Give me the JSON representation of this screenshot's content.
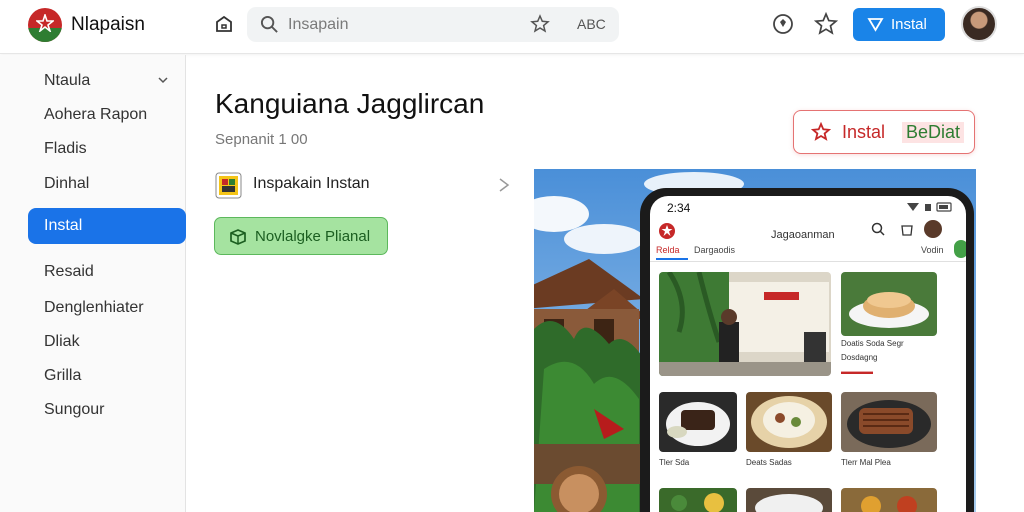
{
  "header": {
    "app_name": "Nlapaisn",
    "search_placeholder": "Insapain",
    "search_abc": "ABC",
    "install_button": "Instal"
  },
  "sidebar": {
    "items": [
      {
        "label": "Ntaula",
        "active": false,
        "chevron": true
      },
      {
        "label": "Aohera Rapon",
        "active": false
      },
      {
        "label": "Fladis",
        "active": false
      },
      {
        "label": "Dinhal",
        "active": false
      },
      {
        "label": "Instal",
        "active": true
      },
      {
        "label": "Resaid",
        "active": false
      },
      {
        "label": "Denglenhiater",
        "active": false
      },
      {
        "label": "Dliak",
        "active": false
      },
      {
        "label": "Grilla",
        "active": false
      },
      {
        "label": "Sungour",
        "active": false
      }
    ]
  },
  "main": {
    "title": "Kanguiana Jagglircan",
    "subtitle": "Sepnanit 1 00",
    "install_button": {
      "part1": "Instal",
      "part2": "BeDiat"
    },
    "package_label": "Inspakain Instan",
    "green_button": "Novlalgke Plianal"
  },
  "phone": {
    "time": "2:34",
    "title": "Jagaoanman",
    "tab_active": "Relda",
    "tab_other": "Dargaodis",
    "more": "Vodin",
    "cards": [
      {
        "caption": "",
        "price": ""
      },
      {
        "caption": "Doatis Soda Segr",
        "price": "Dosdagng"
      },
      {
        "caption": "Tler Sda",
        "price": ""
      },
      {
        "caption": "Deats Sadas",
        "price": ""
      },
      {
        "caption": "Tlerr Mal Plea",
        "price": ""
      }
    ]
  },
  "colors": {
    "primary": "#1a73e8",
    "install_blue": "#1a84e8",
    "red": "#c62828",
    "green": "#2e7d32",
    "green_bg": "#a5e3a0"
  }
}
